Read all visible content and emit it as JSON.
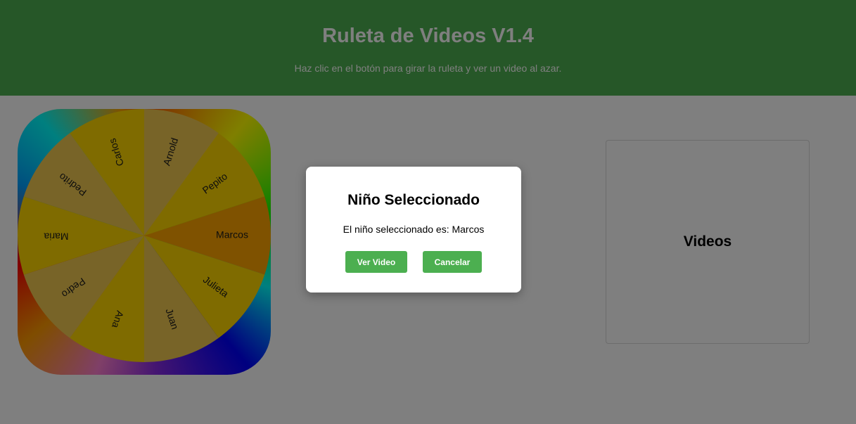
{
  "header": {
    "title": "Ruleta de Videos V1.4",
    "subtitle": "Haz clic en el botón para girar la ruleta y ver un video al azar."
  },
  "wheel": {
    "names": [
      "Marcos",
      "Julieta",
      "Juan",
      "Ana",
      "Pedro",
      "Maria",
      "Pedrito",
      "Carlos",
      "Arnold",
      "Pepito"
    ],
    "slice_colors": [
      "#ffa500",
      "#ffd700",
      "#f0c850",
      "#ffd700",
      "#f0c850",
      "#ffd700",
      "#f0c850",
      "#ffd700",
      "#f0c850",
      "#ffd700"
    ]
  },
  "videos_panel": {
    "title": "Videos"
  },
  "modal": {
    "title": "Niño Seleccionado",
    "message": "El niño seleccionado es: Marcos",
    "ver_video_label": "Ver Video",
    "cancel_label": "Cancelar"
  },
  "colors": {
    "header_bg": "#4caf50",
    "button_bg": "#4caf50",
    "overlay": "rgba(0,0,0,0.5)"
  }
}
